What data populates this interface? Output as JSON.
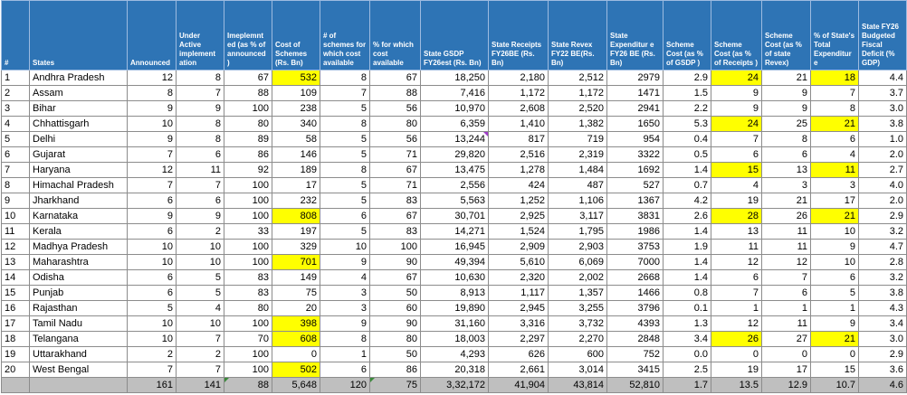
{
  "colors": {
    "header_bg": "#2e74b5",
    "highlight": "#ffff00",
    "total_bg": "#bfbfbf"
  },
  "columns": [
    "#",
    "States",
    "Announced",
    "Under Active implement ation",
    "Imeplemnt ed (as % of announced )",
    "Cost of Schemes (Rs. Bn)",
    "# of schemes for which cost available",
    "% for which cost available",
    "State GSDP FY26est (Rs. Bn)",
    "State Receipts FY26BE (Rs. Bn)",
    "State Revex FY22 BE(Rs. Bn)",
    "State Expenditur e FY26 BE (Rs. Bn)",
    "Scheme Cost (as % of GSDP )",
    "Scheme Cost (as % of Receipts )",
    "Scheme Cost (as % of state Revex)",
    "% of State's Total Expenditur e",
    "State FY26 Budgeted Fiscal Deficit (% GDP)"
  ],
  "rows": [
    [
      "1",
      "Andhra Pradesh",
      "12",
      "8",
      "67",
      "532",
      "8",
      "67",
      "18,250",
      "2,180",
      "2,512",
      "2979",
      "2.9",
      "24",
      "21",
      "18",
      "4.4"
    ],
    [
      "2",
      "Assam",
      "8",
      "7",
      "88",
      "109",
      "7",
      "88",
      "7,416",
      "1,172",
      "1,172",
      "1471",
      "1.5",
      "9",
      "9",
      "7",
      "3.7"
    ],
    [
      "3",
      "Bihar",
      "9",
      "9",
      "100",
      "238",
      "5",
      "56",
      "10,970",
      "2,608",
      "2,520",
      "2941",
      "2.2",
      "9",
      "9",
      "8",
      "3.0"
    ],
    [
      "4",
      "Chhattisgarh",
      "10",
      "8",
      "80",
      "340",
      "8",
      "80",
      "6,359",
      "1,410",
      "1,382",
      "1650",
      "5.3",
      "24",
      "25",
      "21",
      "3.8"
    ],
    [
      "5",
      "Delhi",
      "9",
      "8",
      "89",
      "58",
      "5",
      "56",
      "13,244",
      "817",
      "719",
      "954",
      "0.4",
      "7",
      "8",
      "6",
      "1.0"
    ],
    [
      "6",
      "Gujarat",
      "7",
      "6",
      "86",
      "146",
      "5",
      "71",
      "29,820",
      "2,516",
      "2,319",
      "3322",
      "0.5",
      "6",
      "6",
      "4",
      "2.0"
    ],
    [
      "7",
      "Haryana",
      "12",
      "11",
      "92",
      "189",
      "8",
      "67",
      "13,475",
      "1,278",
      "1,484",
      "1692",
      "1.4",
      "15",
      "13",
      "11",
      "2.7"
    ],
    [
      "8",
      "Himachal Pradesh",
      "7",
      "7",
      "100",
      "17",
      "5",
      "71",
      "2,556",
      "424",
      "487",
      "527",
      "0.7",
      "4",
      "3",
      "3",
      "4.0"
    ],
    [
      "9",
      "Jharkhand",
      "6",
      "6",
      "100",
      "232",
      "5",
      "83",
      "5,563",
      "1,252",
      "1,106",
      "1367",
      "4.2",
      "19",
      "21",
      "17",
      "2.0"
    ],
    [
      "10",
      "Karnataka",
      "9",
      "9",
      "100",
      "808",
      "6",
      "67",
      "30,701",
      "2,925",
      "3,117",
      "3831",
      "2.6",
      "28",
      "26",
      "21",
      "2.9"
    ],
    [
      "11",
      "Kerala",
      "6",
      "2",
      "33",
      "197",
      "5",
      "83",
      "14,271",
      "1,524",
      "1,795",
      "1986",
      "1.4",
      "13",
      "11",
      "10",
      "3.2"
    ],
    [
      "12",
      "Madhya Pradesh",
      "10",
      "10",
      "100",
      "329",
      "10",
      "100",
      "16,945",
      "2,909",
      "2,903",
      "3753",
      "1.9",
      "11",
      "11",
      "9",
      "4.7"
    ],
    [
      "13",
      "Maharashtra",
      "10",
      "10",
      "100",
      "701",
      "9",
      "90",
      "49,394",
      "5,610",
      "6,069",
      "7000",
      "1.4",
      "12",
      "12",
      "10",
      "2.8"
    ],
    [
      "14",
      "Odisha",
      "6",
      "5",
      "83",
      "149",
      "4",
      "67",
      "10,630",
      "2,320",
      "2,002",
      "2668",
      "1.4",
      "6",
      "7",
      "6",
      "3.2"
    ],
    [
      "15",
      "Punjab",
      "6",
      "5",
      "83",
      "75",
      "3",
      "50",
      "8,913",
      "1,117",
      "1,357",
      "1466",
      "0.8",
      "7",
      "6",
      "5",
      "3.8"
    ],
    [
      "16",
      "Rajasthan",
      "5",
      "4",
      "80",
      "20",
      "3",
      "60",
      "19,890",
      "2,945",
      "3,255",
      "3796",
      "0.1",
      "1",
      "1",
      "1",
      "4.3"
    ],
    [
      "17",
      "Tamil Nadu",
      "10",
      "10",
      "100",
      "398",
      "9",
      "90",
      "31,160",
      "3,316",
      "3,732",
      "4393",
      "1.3",
      "12",
      "11",
      "9",
      "3.4"
    ],
    [
      "18",
      "Telangana",
      "10",
      "7",
      "70",
      "608",
      "8",
      "80",
      "18,003",
      "2,297",
      "2,270",
      "2848",
      "3.4",
      "26",
      "27",
      "21",
      "3.0"
    ],
    [
      "19",
      "Uttarakhand",
      "2",
      "2",
      "100",
      "0",
      "1",
      "50",
      "4,293",
      "626",
      "600",
      "752",
      "0.0",
      "0",
      "0",
      "0",
      "2.9"
    ],
    [
      "20",
      "West Bengal",
      "7",
      "7",
      "100",
      "502",
      "6",
      "86",
      "20,318",
      "2,661",
      "3,014",
      "3415",
      "2.5",
      "19",
      "17",
      "15",
      "3.6"
    ]
  ],
  "highlights": {
    "0": [
      5,
      13,
      15
    ],
    "3": [
      13,
      15
    ],
    "6": [
      13,
      15
    ],
    "9": [
      5,
      13,
      15
    ],
    "12": [
      5
    ],
    "16": [
      5
    ],
    "17": [
      5,
      13,
      15
    ],
    "19": [
      5
    ]
  },
  "total": [
    "",
    "",
    "161",
    "141",
    "88",
    "5,648",
    "120",
    "75",
    "3,32,172",
    "41,904",
    "43,814",
    "52,810",
    "1.7",
    "13.5",
    "12.9",
    "10.7",
    "4.6"
  ]
}
